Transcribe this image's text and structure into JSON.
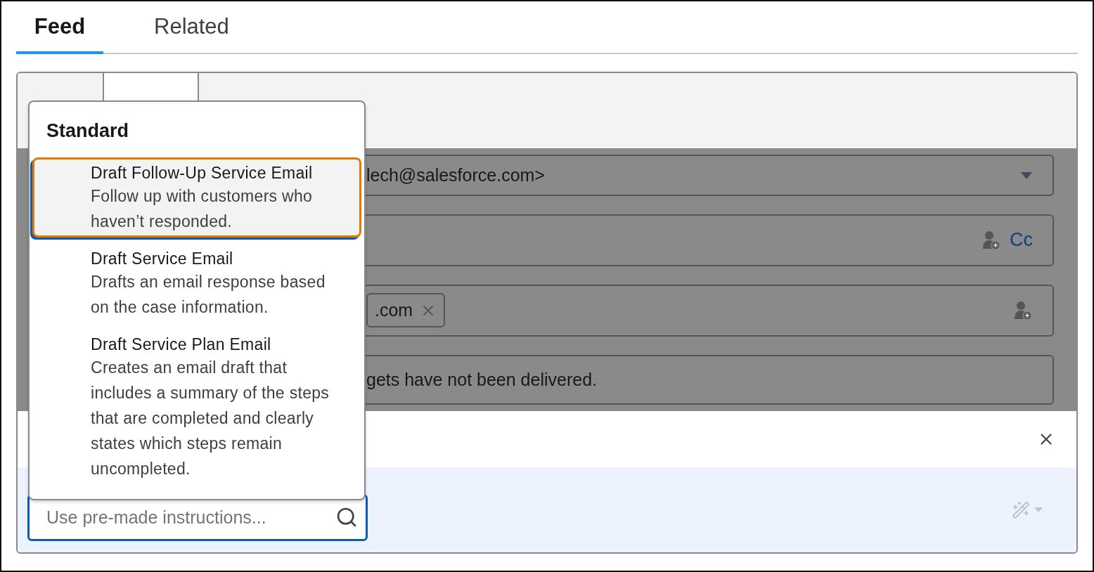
{
  "tabs": [
    {
      "label": "Feed",
      "selected": true
    },
    {
      "label": "Related",
      "selected": false
    }
  ],
  "composer": {
    "from": {
      "value": "lech@salesforce.com>"
    },
    "to": {
      "cc_label": "Cc"
    },
    "bcc": {
      "chips": [
        {
          "label": ".com"
        }
      ]
    },
    "subject": {
      "value": "gets have not been delivered."
    }
  },
  "instructions_menu": {
    "group": "Standard",
    "items": [
      {
        "title": "Draft Follow-Up Service Email",
        "description": "Follow up with customers who haven’t responded.",
        "selected": true
      },
      {
        "title": "Draft Service Email",
        "description": "Drafts an email response based on the case information.",
        "selected": false
      },
      {
        "title": "Draft Service Plan Email",
        "description": "Creates an email draft that includes a summary of the steps that are completed and clearly states which steps remain uncompleted.",
        "selected": false
      }
    ]
  },
  "search": {
    "placeholder": "Use pre-made instructions..."
  }
}
